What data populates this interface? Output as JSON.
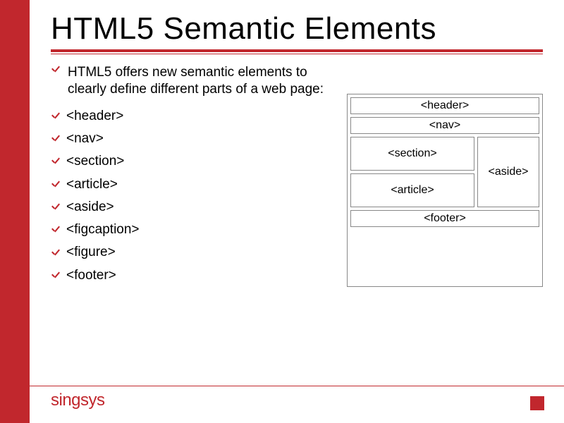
{
  "title": "HTML5 Semantic Elements",
  "intro": "HTML5 offers new semantic elements to clearly define different parts of a web page:",
  "items": [
    "<header>",
    "<nav>",
    "<section>",
    "<article>",
    "<aside>",
    "<figcaption>",
    "<figure>",
    "<footer>"
  ],
  "diagram": {
    "header": "<header>",
    "nav": "<nav>",
    "section": "<section>",
    "article": "<article>",
    "aside": "<aside>",
    "footer": "<footer>"
  },
  "logo": "singsys"
}
